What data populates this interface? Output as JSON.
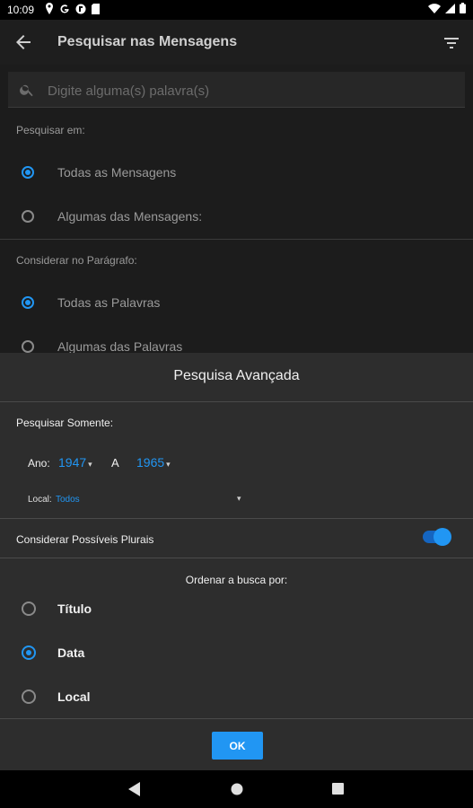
{
  "status": {
    "time": "10:09"
  },
  "header": {
    "title": "Pesquisar nas Mensagens"
  },
  "search": {
    "placeholder": "Digite alguma(s) palavra(s)",
    "value": ""
  },
  "search_in": {
    "label": "Pesquisar em:",
    "options": [
      {
        "label": "Todas as Mensagens",
        "checked": true
      },
      {
        "label": "Algumas das Mensagens:",
        "checked": false
      }
    ]
  },
  "paragraph": {
    "label": "Considerar no Parágrafo:",
    "options": [
      {
        "label": "Todas as Palavras",
        "checked": true
      },
      {
        "label": "Algumas das Palavras",
        "checked": false
      }
    ]
  },
  "dialog": {
    "title": "Pesquisa Avançada",
    "only_label": "Pesquisar Somente:",
    "year_label": "Ano:",
    "year_from": "1947",
    "to_label": "A",
    "year_to": "1965",
    "place_label": "Local:",
    "place_value": "Todos",
    "plurals_label": "Considerar Possíveis Plurais",
    "plurals_enabled": true,
    "order_label": "Ordenar a busca por:",
    "order_options": [
      {
        "label": "Título",
        "checked": false
      },
      {
        "label": "Data",
        "checked": true
      },
      {
        "label": "Local",
        "checked": false
      }
    ],
    "ok_label": "OK"
  },
  "colors": {
    "accent": "#2196f3",
    "background": "#1c1c1c",
    "dialog": "#2d2d2d"
  }
}
